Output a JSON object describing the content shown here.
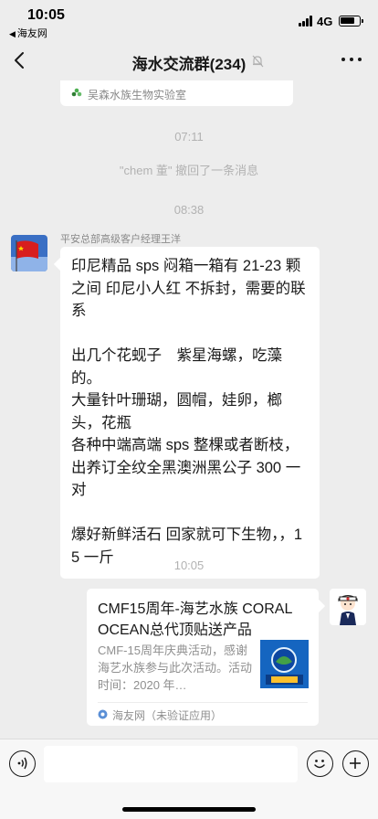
{
  "status_bar": {
    "time": "10:05",
    "back_app": "海友网",
    "network": "4G"
  },
  "nav": {
    "title": "海水交流群(234)",
    "icons": [
      "back-arrow-icon",
      "mute-bell-icon",
      "more-dots-icon"
    ]
  },
  "top_card": {
    "source": "吴森水族生物实验室"
  },
  "timestamps": [
    "07:11",
    "08:38",
    "10:05"
  ],
  "system_message": "\"chem 董\" 撤回了一条消息",
  "message1": {
    "sender": "平安总部高级客户经理王洋",
    "text": "印尼精品 sps 闷箱一箱有 21-23 颗之间 印尼小人红 不拆封，需要的联系\n\n出几个花蚬子　紫星海螺，吃藻的。\n大量针叶珊瑚，圆帽，娃卵，榔头，花瓶\n各种中端高端 sps 整棵或者断枝，出养订全纹全黑澳洲黑公子 300 一对\n\n爆好新鲜活石 回家就可下生物，，15 一斤"
  },
  "share_card": {
    "title": "CMF15周年-海艺水族 CORAL OCEAN总代顶贴送产品",
    "description": "CMF-15周年庆典活动，感谢海艺水族参与此次活动。活动时间：2020 年…",
    "source": "海友网（未验证应用）"
  },
  "colors": {
    "background": "#ededed",
    "bubble": "#ffffff",
    "meta_text": "#b2b2b2"
  }
}
